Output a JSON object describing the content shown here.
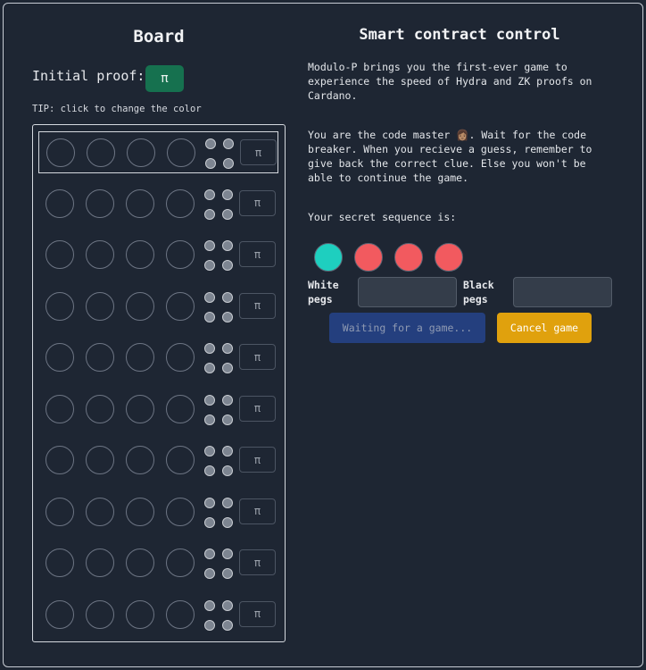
{
  "board": {
    "title": "Board",
    "initial_proof_label": "Initial proof:",
    "initial_proof_button": "π",
    "tip": "TIP: click to change the color",
    "row_button_label": "π",
    "row_count": 10,
    "active_row": 0
  },
  "control": {
    "title": "Smart contract control",
    "intro": "Modulo-P brings you the first-ever game to experience the speed of Hydra and ZK proofs on Cardano.",
    "instructions": "You are the code master 👩🏽. Wait for the code breaker. When you recieve a guess, remember to give back the correct clue. Else you won't be able to continue the game.",
    "secret_label": "Your secret sequence is:",
    "secret_sequence": [
      "#1ecfbf",
      "#f25a5f",
      "#f25a5f",
      "#f25a5f"
    ],
    "white_pegs_label": "White pegs",
    "white_pegs_value": "",
    "black_pegs_label": "Black pegs",
    "black_pegs_value": "",
    "waiting_button": "Waiting for a game...",
    "cancel_button": "Cancel game"
  },
  "colors": {
    "background": "#1e2633",
    "proof_button": "#16714f",
    "waiting_button": "#243f7e",
    "cancel_button": "#e0a10d"
  }
}
